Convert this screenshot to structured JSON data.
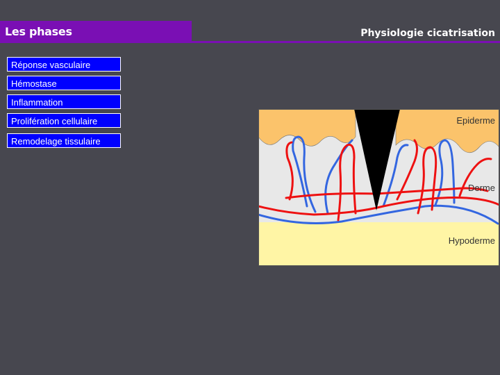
{
  "header": {
    "section_title": "Les phases",
    "page_title": "Physiologie cicatrisation",
    "accent_color": "#7a0fb4"
  },
  "phases": [
    {
      "label": "Réponse vasculaire"
    },
    {
      "label": "Hémostase"
    },
    {
      "label": "Inflammation"
    },
    {
      "label": "Prolifération cellulaire"
    },
    {
      "label": "Remodelage tissulaire"
    }
  ],
  "diagram": {
    "labels": {
      "epiderme": "Epiderme",
      "derme": "Derme",
      "hypoderme": "Hypoderme"
    },
    "colors": {
      "epiderme": "#fbc36b",
      "derme": "#e8e8e8",
      "hypoderme": "#fff5a5",
      "artery": "#ee1111",
      "vein": "#3366e0",
      "wound": "#000000"
    }
  }
}
